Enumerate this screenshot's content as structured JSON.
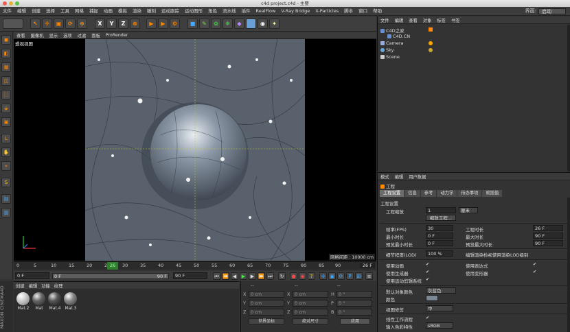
{
  "window": {
    "title": "c4d project.c4d - 主要"
  },
  "menubar": {
    "items": [
      "文件",
      "编辑",
      "创建",
      "选择",
      "工具",
      "网格",
      "捕捉",
      "动画",
      "模拟",
      "渲染",
      "雕刻",
      "运动跟踪",
      "运动图形",
      "角色",
      "流水线",
      "插件",
      "RealFlow",
      "V-Ray Bridge",
      "X-Particles",
      "脚本",
      "窗口",
      "帮助"
    ],
    "layout_label": "界面:",
    "layout_value": "启动"
  },
  "viewport": {
    "menu": [
      "查看",
      "摄像机",
      "显示",
      "选项",
      "过滤",
      "面板",
      "ProRender"
    ],
    "label": "透视视图",
    "grid_info": "网格间距 : 10000 cm"
  },
  "timeline": {
    "ticks": [
      "0",
      "5",
      "10",
      "15",
      "20",
      "25",
      "30",
      "35",
      "40",
      "45",
      "50",
      "55",
      "60",
      "65",
      "70",
      "75",
      "80",
      "85",
      "90"
    ],
    "current_frame": "26",
    "end_label": "26 F"
  },
  "transport": {
    "start": "0 F",
    "min": "0 F",
    "max": "90 F",
    "end": "90 F"
  },
  "materials": {
    "menu": [
      "创建",
      "编辑",
      "功能",
      "纹理"
    ],
    "items": [
      {
        "name": "Mat.2"
      },
      {
        "name": "Mat"
      },
      {
        "name": "Mat.4"
      },
      {
        "name": "Mat.3"
      }
    ],
    "brand": "MAXON CINEMA4D"
  },
  "coords": {
    "header": [
      "--",
      "--",
      "--"
    ],
    "rows": [
      {
        "a": "X",
        "av": "0 cm",
        "b": "X",
        "bv": "0 cm",
        "c": "H",
        "cv": "0 °"
      },
      {
        "a": "Y",
        "av": "0 cm",
        "b": "Y",
        "bv": "0 cm",
        "c": "P",
        "cv": "0 °"
      },
      {
        "a": "Z",
        "av": "0 cm",
        "b": "Z",
        "bv": "0 cm",
        "c": "B",
        "cv": "0 °"
      }
    ],
    "mode1": "世界坐标",
    "mode2": "绝对尺寸",
    "apply": "应用"
  },
  "objects": {
    "menu": [
      "文件",
      "编辑",
      "查看",
      "对象",
      "标签",
      "书签"
    ],
    "items": [
      {
        "name": "C4D之家",
        "indent": 0,
        "color": "#6a8fd0"
      },
      {
        "name": "C4D.CN",
        "indent": 8,
        "color": "#6a8fd0"
      },
      {
        "name": "Camera",
        "indent": 0,
        "color": "#9ad"
      },
      {
        "name": "Sky",
        "indent": 0,
        "color": "#6ad"
      },
      {
        "name": "Scene",
        "indent": 0,
        "color": "#ccc"
      }
    ]
  },
  "attributes": {
    "menu": [
      "模式",
      "编辑",
      "用户数据"
    ],
    "title": "工程",
    "tabs": [
      "工程设置",
      "信息",
      "参考",
      "动力学",
      "待办事项",
      "帧插值"
    ],
    "section": "工程设置",
    "scale_label": "工程缩放",
    "scale_value": "1",
    "scale_unit": "厘米",
    "scale_button": "缩放工程...",
    "fps_label": "帧率(FPS)",
    "fps": "30",
    "duration_label": "工程时长",
    "duration": "26 F",
    "min_label": "最小时长",
    "min": "0 F",
    "max_label": "最大时长",
    "max": "90 F",
    "pmin_label": "预览最小时长",
    "pmin": "0 F",
    "pmax_label": "预览最大时长",
    "pmax": "90 F",
    "lod_label": "细节程度(LOD)",
    "lod": "100 %",
    "lod_note": "编辑渲染检视使用渲染LOD级别",
    "checks_left": [
      "使用动画",
      "使用生成器",
      "使用运动剪辑系统"
    ],
    "checks_right": [
      "使用表达式",
      "使用变形器"
    ],
    "objcolor_label": "默认对象颜色",
    "objcolor_value": "灰蓝色",
    "color_label": "颜色",
    "clip_label": "视图修剪",
    "clip_value": "中",
    "linear_label": "线性工作流程",
    "input_label": "输入色彩特性",
    "input_value": "sRGB"
  }
}
